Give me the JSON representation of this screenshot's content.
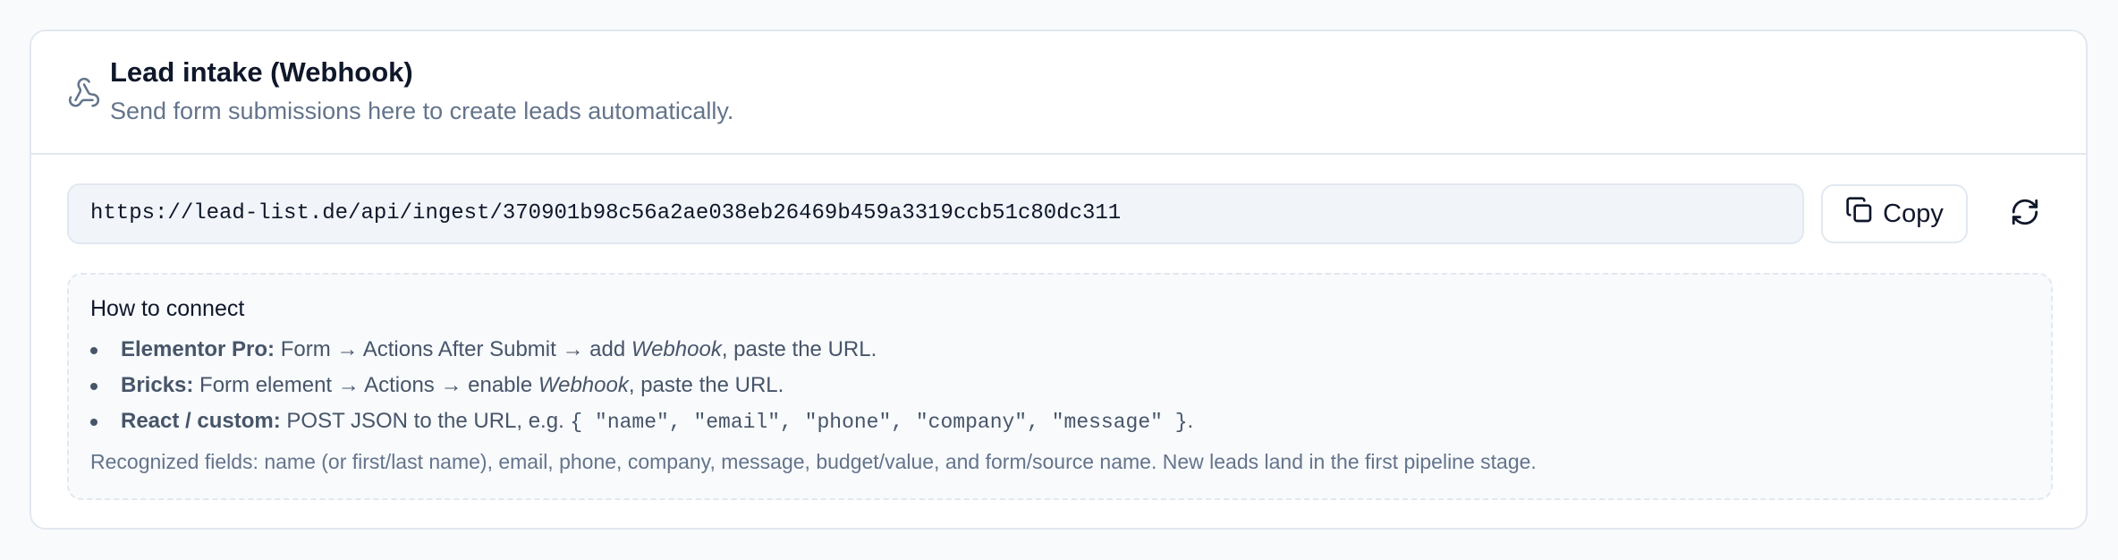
{
  "header": {
    "icon": "webhook-icon",
    "title": "Lead intake (Webhook)",
    "subtitle": "Send form submissions here to create leads automatically."
  },
  "webhook": {
    "url": "https://lead-list.de/api/ingest/370901b98c56a2ae038eb26469b459a3319ccb51c80dc311",
    "copy_label": "Copy",
    "copy_icon": "copy-icon",
    "refresh_icon": "refresh-icon"
  },
  "help": {
    "title": "How to connect",
    "steps": [
      {
        "name": "Elementor Pro:",
        "before": "Form → Actions After Submit → add",
        "em": "Webhook",
        "after": ", paste the URL."
      },
      {
        "name": "Bricks:",
        "before": "Form element → Actions → enable",
        "em": "Webhook",
        "after": ", paste the URL."
      },
      {
        "name": "React / custom:",
        "before": "POST JSON to the URL, e.g.",
        "code": "{ \"name\", \"email\", \"phone\", \"company\", \"message\" }",
        "after": "."
      }
    ],
    "footnote": "Recognized fields: name (or first/last name), email, phone, company, message, budget/value, and form/source name. New leads land in the first pipeline stage."
  },
  "colors": {
    "text_primary": "#0f172a",
    "text_muted": "#64748b",
    "text_body": "#475569",
    "border": "#e2e8f0",
    "field_bg": "#f1f5f9",
    "page_bg": "#f8fafc"
  }
}
